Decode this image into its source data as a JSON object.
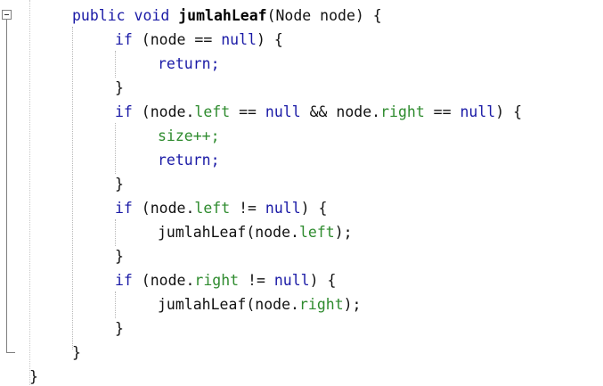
{
  "code_lines": [
    [
      "public void ",
      "jumlahLeaf",
      "(Node node) {"
    ],
    [
      "if",
      " (node == ",
      "null",
      ") {"
    ],
    [
      "return;"
    ],
    [
      "}"
    ],
    [
      "if",
      " (node.",
      "left",
      " == ",
      "null",
      " && node.",
      "right",
      " == ",
      "null",
      ") {"
    ],
    [
      "size++;"
    ],
    [
      "return;"
    ],
    [
      "}"
    ],
    [
      "if",
      " (node.",
      "left",
      " != ",
      "null",
      ") {"
    ],
    [
      "jumlahLeaf(node.",
      "left",
      ");"
    ],
    [
      "}"
    ],
    [
      "if",
      " (node.",
      "right",
      " != ",
      "null",
      ") {"
    ],
    [
      "jumlahLeaf(node.",
      "right",
      ");"
    ],
    [
      "}"
    ],
    [
      "}"
    ],
    [
      "}"
    ]
  ],
  "colors": {
    "keyword": "#1a1aa6",
    "member": "#2e8b2e",
    "text": "#111111",
    "background": "#ffffff"
  },
  "icons": {
    "fold_toggle": "minus-box-icon"
  }
}
